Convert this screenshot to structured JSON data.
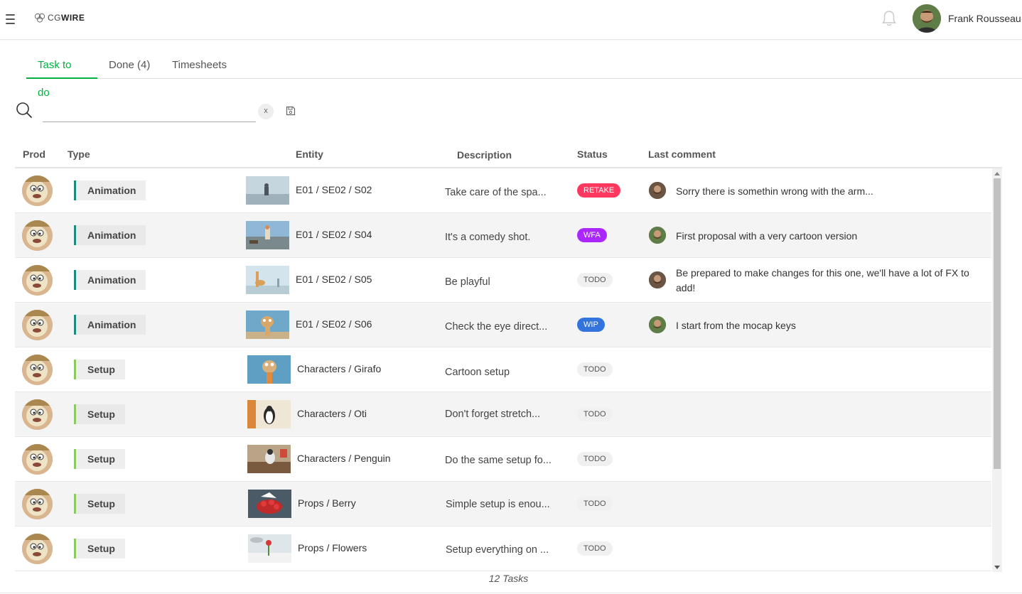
{
  "header": {
    "logo_prefix": "CG",
    "logo_bold": "WIRE",
    "user_name": "Frank Rousseau"
  },
  "tabs": [
    {
      "label": "Task to do",
      "active": true
    },
    {
      "label": "Done (4)",
      "active": false
    },
    {
      "label": "Timesheets",
      "active": false
    }
  ],
  "search": {
    "value": "",
    "placeholder": "",
    "clear_label": "x"
  },
  "table": {
    "columns": {
      "prod": "Prod",
      "type": "Type",
      "entity": "Entity",
      "description": "Description",
      "status": "Status",
      "last_comment": "Last comment"
    },
    "rows": [
      {
        "type": "Animation",
        "entity": "E01 / SE02 / S02",
        "description": "Take care of the spa...",
        "status": "RETAKE",
        "comment": "Sorry there is somethin wrong with the arm..."
      },
      {
        "type": "Animation",
        "entity": "E01 / SE02 / S04",
        "description": "It's a comedy shot.",
        "status": "WFA",
        "comment": "First proposal with a very cartoon version"
      },
      {
        "type": "Animation",
        "entity": "E01 / SE02 / S05",
        "description": "Be playful",
        "status": "TODO",
        "comment": "Be prepared to make changes for this one, we'll have a lot of FX to add!"
      },
      {
        "type": "Animation",
        "entity": "E01 / SE02 / S06",
        "description": "Check the eye direct...",
        "status": "WIP",
        "comment": "I start from the mocap keys"
      },
      {
        "type": "Setup",
        "entity": "Characters / Girafo",
        "description": "Cartoon setup",
        "status": "TODO",
        "comment": ""
      },
      {
        "type": "Setup",
        "entity": "Characters / Oti",
        "description": "Don't forget stretch...",
        "status": "TODO",
        "comment": ""
      },
      {
        "type": "Setup",
        "entity": "Characters / Penguin",
        "description": "Do the same setup fo...",
        "status": "TODO",
        "comment": ""
      },
      {
        "type": "Setup",
        "entity": "Props / Berry",
        "description": "Simple setup is enou...",
        "status": "TODO",
        "comment": ""
      },
      {
        "type": "Setup",
        "entity": "Props / Flowers",
        "description": "Setup everything on ...",
        "status": "TODO",
        "comment": ""
      }
    ]
  },
  "footer": {
    "count": "12 Tasks"
  },
  "colors": {
    "accent": "#00b242",
    "animation_tag": "#1a8b7d",
    "setup_tag": "#8cc864",
    "retake": "#ff3860",
    "wfa": "#ab26ff",
    "wip": "#3273dc",
    "todo": "#f0f0f0"
  }
}
